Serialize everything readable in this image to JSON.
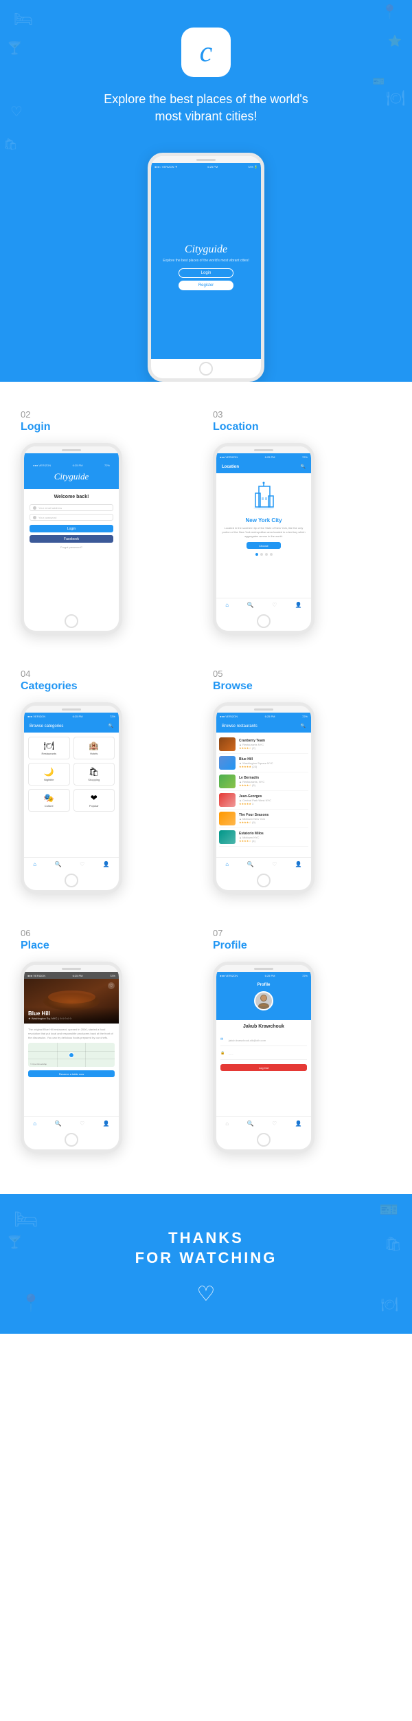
{
  "hero": {
    "app_icon_letter": "c",
    "title_line1": "Explore the best places of the world's",
    "title_line2": "most vibrant cities!",
    "screen": {
      "app_name": "Cityguide",
      "subtitle": "Explore the best places of the world's most vibrant cities!",
      "login_btn": "Login",
      "register_btn": "Register"
    }
  },
  "sections": {
    "login": {
      "number": "02",
      "label": "Login",
      "welcome": "Welcome back!",
      "email_placeholder": "Your email address",
      "password_placeholder": "Your password",
      "login_btn": "Login",
      "facebook_btn": "Facebook",
      "forgot_text": "Forgot password?"
    },
    "location": {
      "number": "03",
      "label": "Location",
      "header": "Location",
      "city": "New York City",
      "description": "Located in the southern tip of the State of New York, like the only portion of the New York metropolitan area located in a territory which aggregates across in the world.",
      "choose_btn": "Choose"
    },
    "categories": {
      "number": "04",
      "label": "Categories",
      "header": "Browse categories",
      "items": [
        {
          "icon": "🍽",
          "name": "Restaurants"
        },
        {
          "icon": "🏨",
          "name": "Hotels"
        },
        {
          "icon": "🌙",
          "name": "Nightlife"
        },
        {
          "icon": "🛍",
          "name": "Shopping"
        },
        {
          "icon": "🎭",
          "name": "Culture"
        },
        {
          "icon": "❤",
          "name": "Popular"
        }
      ]
    },
    "browse": {
      "number": "05",
      "label": "Browse",
      "header": "Browse restaurants",
      "items": [
        {
          "name": "Cranberry Team",
          "location": "▲ Restaurants NYC",
          "rating": "★★★★☆",
          "reviews": "(2)",
          "thumb_class": "thumb-cranberry"
        },
        {
          "name": "Blue Hill",
          "location": "▲ Washington Square NYC",
          "rating": "★★★★★",
          "reviews": "(23)",
          "thumb_class": "thumb-blue"
        },
        {
          "name": "Le Bernadin",
          "location": "▲ Restaurants, NYC",
          "rating": "★★★★☆",
          "reviews": "(5)",
          "thumb_class": "thumb-green"
        },
        {
          "name": "Jean-Georges",
          "location": "▲ Central Park West NYC",
          "rating": "★★★★★",
          "reviews": "3",
          "thumb_class": "thumb-red"
        },
        {
          "name": "The Four Seasons",
          "location": "▲ Midtown New York",
          "rating": "★★★★☆",
          "reviews": "(9)",
          "thumb_class": "thumb-orange"
        },
        {
          "name": "Estatorio Milos",
          "location": "▲ Midtown NYC",
          "rating": "★★★★☆",
          "reviews": "(4)",
          "thumb_class": "thumb-teal"
        }
      ]
    },
    "place": {
      "number": "06",
      "label": "Place",
      "name": "Blue Hill",
      "location": "★ Washington Sq. NYC | ☆☆☆☆☆",
      "description": "The original Blue Hill restaurant, opened in 2000, started a food revolution that put local and responsible producers back at the front of the discussion. You can try delicious foods prepared by our chefs.",
      "reserve_btn": "Reserve a table now"
    },
    "profile": {
      "number": "07",
      "label": "Profile",
      "header": "Profile",
      "name": "Jakub Krawchouk",
      "email": "jakub.krawchouk.oik@oih.com",
      "field2": "......",
      "logout_btn": "Log Out"
    }
  },
  "footer": {
    "line1": "THANKS",
    "line2": "FOR WATCHING",
    "heart": "♡"
  }
}
